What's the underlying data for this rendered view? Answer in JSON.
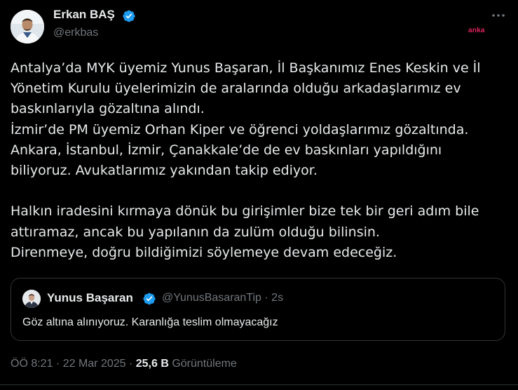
{
  "author": {
    "name": "Erkan BAŞ",
    "handle": "@erkbas"
  },
  "watermark": "anka",
  "tweet_lines": [
    "Antalya’da MYK üyemiz Yunus Başaran, İl Başkanımız Enes Keskin ve İl",
    "Yönetim Kurulu üyelerimizin de aralarında olduğu arkadaşlarımız ev",
    "baskınlarıyla gözaltına alındı.",
    "İzmir’de PM üyemiz Orhan Kiper ve öğrenci yoldaşlarımız gözaltında.",
    "Ankara, İstanbul, İzmir, Çanakkale’de de ev baskınları yapıldığını",
    "biliyoruz. Avukatlarımız yakından takip ediyor.",
    "",
    "Halkın iradesini kırmaya dönük bu girişimler bize tek bir geri adım bile",
    "attıramaz, ancak bu yapılanın da zulüm olduğu bilinsin.",
    "Direnmeye, doğru bildiğimizi söylemeye devam edeceğiz."
  ],
  "quote": {
    "name": "Yunus Başaran",
    "handle_time": "@YunusBasaranTip · 2s",
    "text": "Göz altına alınıyoruz. Karanlığa teslim olmayacağız"
  },
  "meta": {
    "timestamp": "ÖÖ 8:21 · 22 Mar 2025 · ",
    "views_count": "25,6 B",
    "views_label": " Görüntüleme"
  },
  "colors": {
    "background": "#000000",
    "text": "#e7e9ea",
    "secondary": "#71767b",
    "verified": "#1d9bf0",
    "border": "#2f3336",
    "watermark": "#e0245e"
  },
  "icons": {
    "verified": "verified-badge-icon",
    "more": "more-options-icon"
  }
}
